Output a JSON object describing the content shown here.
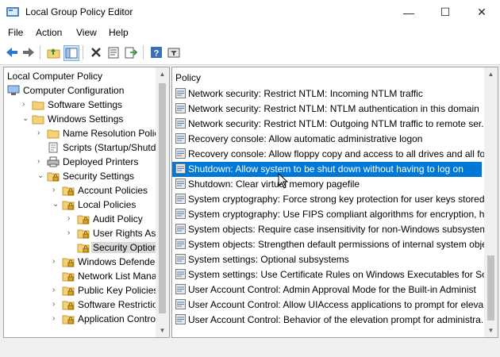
{
  "window": {
    "title": "Local Group Policy Editor",
    "minimize_glyph": "—",
    "maximize_glyph": "☐",
    "close_glyph": "✕"
  },
  "menu": [
    "File",
    "Action",
    "View",
    "Help"
  ],
  "toolbar": {
    "icons": [
      "back-arrow-icon",
      "forward-arrow-icon",
      "up-folder-icon",
      "show-hide-tree-icon",
      "delete-icon",
      "properties-icon",
      "export-list-icon",
      "help-icon",
      "filter-icon"
    ]
  },
  "tree": [
    {
      "label": "Local Computer Policy",
      "level": 0,
      "expander": "",
      "icon": "computer"
    },
    {
      "label": "Computer Configuration",
      "level": 0,
      "expander": "⌄",
      "icon": "computer"
    },
    {
      "label": "Software Settings",
      "level": 1,
      "expander": "›",
      "icon": "folder"
    },
    {
      "label": "Windows Settings",
      "level": 1,
      "expander": "⌄",
      "icon": "folder"
    },
    {
      "label": "Name Resolution Policy",
      "level": 2,
      "expander": "›",
      "icon": "folder"
    },
    {
      "label": "Scripts (Startup/Shutdow",
      "level": 2,
      "expander": "",
      "icon": "script"
    },
    {
      "label": "Deployed Printers",
      "level": 2,
      "expander": "›",
      "icon": "printer"
    },
    {
      "label": "Security Settings",
      "level": 2,
      "expander": "⌄",
      "icon": "lock-folder"
    },
    {
      "label": "Account Policies",
      "level": 3,
      "expander": "›",
      "icon": "lock-folder"
    },
    {
      "label": "Local Policies",
      "level": 3,
      "expander": "⌄",
      "icon": "lock-folder"
    },
    {
      "label": "Audit Policy",
      "level": 4,
      "expander": "›",
      "icon": "lock-folder"
    },
    {
      "label": "User Rights Assig",
      "level": 4,
      "expander": "›",
      "icon": "lock-folder"
    },
    {
      "label": "Security Options",
      "level": 4,
      "expander": "",
      "icon": "lock-folder",
      "selected": true
    },
    {
      "label": "Windows Defender F",
      "level": 3,
      "expander": "›",
      "icon": "lock-folder"
    },
    {
      "label": "Network List Manage",
      "level": 3,
      "expander": "",
      "icon": "lock-folder"
    },
    {
      "label": "Public Key Policies",
      "level": 3,
      "expander": "›",
      "icon": "lock-folder"
    },
    {
      "label": "Software Restriction",
      "level": 3,
      "expander": "›",
      "icon": "lock-folder"
    },
    {
      "label": "Application Control I",
      "level": 3,
      "expander": "›",
      "icon": "lock-folder"
    }
  ],
  "list": {
    "header": "Policy",
    "items": [
      "Network security: Restrict NTLM: Incoming NTLM traffic",
      "Network security: Restrict NTLM: NTLM authentication in this domain",
      "Network security: Restrict NTLM: Outgoing NTLM traffic to remote ser...",
      "Recovery console: Allow automatic administrative logon",
      "Recovery console: Allow floppy copy and access to all drives and all fol",
      "Shutdown: Allow system to be shut down without having to log on",
      "Shutdown: Clear virtual memory pagefile",
      "System cryptography: Force strong key protection for user keys stored ...",
      "System cryptography: Use FIPS compliant algorithms for encryption, h...",
      "System objects: Require case insensitivity for non-Windows subsystems",
      "System objects: Strengthen default permissions of internal system obje",
      "System settings: Optional subsystems",
      "System settings: Use Certificate Rules on Windows Executables for Soft...",
      "User Account Control: Admin Approval Mode for the Built-in Administ",
      "User Account Control: Allow UIAccess applications to prompt for eleva",
      "User Account Control: Behavior of the elevation prompt for administra..."
    ],
    "selected_index": 5
  },
  "colors": {
    "selection": "#0078d7",
    "tree_selection": "#d9d9d9",
    "folder": "#f4d27a"
  }
}
